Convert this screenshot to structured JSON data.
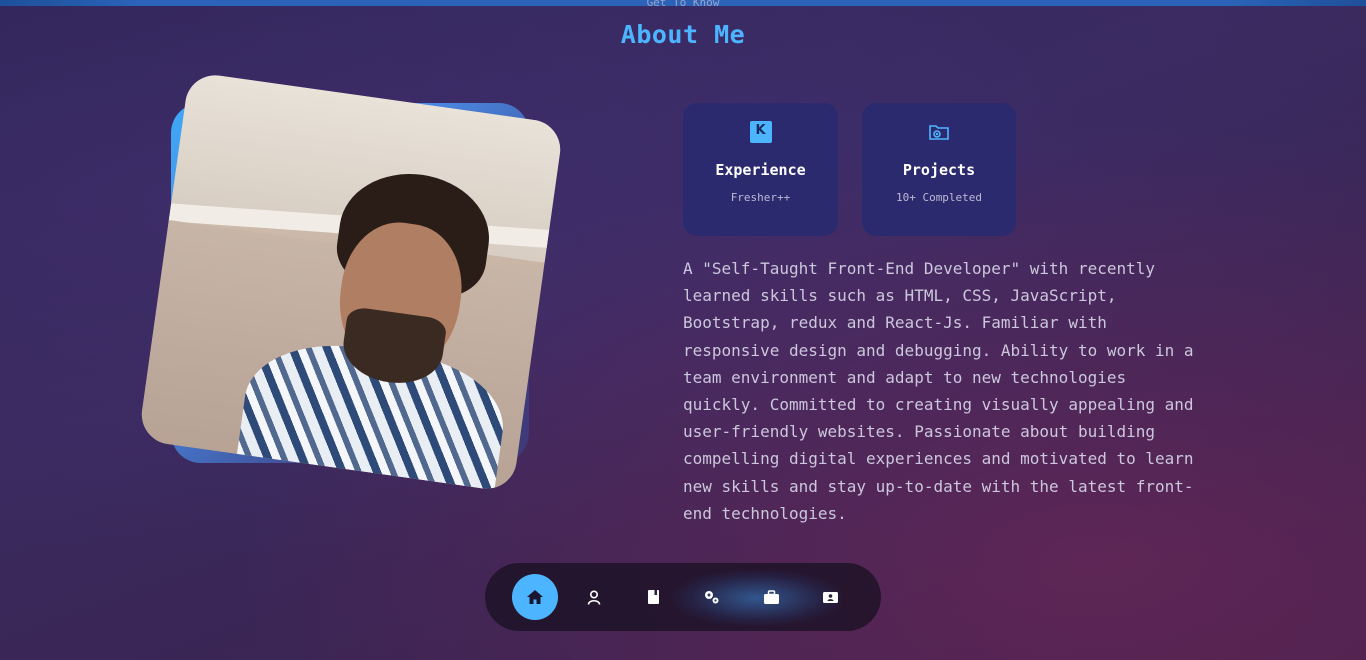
{
  "header": {
    "subtitle": "Get To Know",
    "title": "About Me"
  },
  "cards": [
    {
      "icon": "award-k-icon",
      "title": "Experience",
      "subtitle": "Fresher++"
    },
    {
      "icon": "folder-icon",
      "title": "Projects",
      "subtitle": "10+ Completed"
    }
  ],
  "about": {
    "description": "A \"Self-Taught Front-End Developer\" with recently learned skills such as HTML, CSS, JavaScript, Bootstrap, redux and React-Js. Familiar with responsive design and debugging. Ability to work in a team environment and adapt to new technologies quickly. Committed to creating visually appealing and user-friendly websites. Passionate about building compelling digital experiences and motivated to learn new skills and stay up-to-date with the latest front-end technologies."
  },
  "nav": {
    "items": [
      {
        "icon": "home-icon",
        "active": true
      },
      {
        "icon": "user-icon",
        "active": false
      },
      {
        "icon": "book-icon",
        "active": false
      },
      {
        "icon": "gears-icon",
        "active": false
      },
      {
        "icon": "briefcase-icon",
        "active": false
      },
      {
        "icon": "contact-card-icon",
        "active": false
      }
    ]
  },
  "colors": {
    "accent": "#4db5ff",
    "card_bg": "#2c2a6e",
    "topbar": "#2a63b8"
  }
}
